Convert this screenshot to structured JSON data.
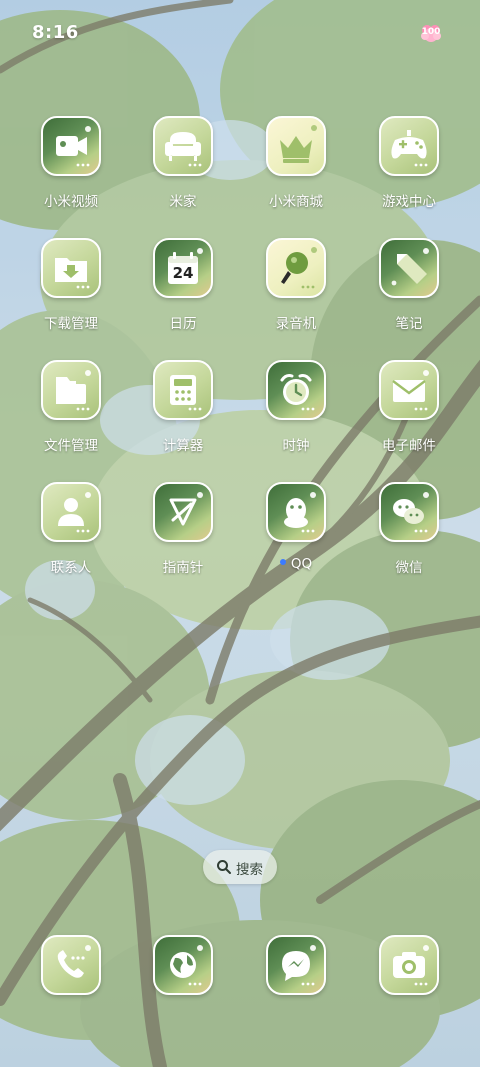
{
  "status_bar": {
    "time": "8:16",
    "battery_level": "100"
  },
  "apps": [
    {
      "label": "小米视频",
      "icon": "video-camera-icon"
    },
    {
      "label": "米家",
      "icon": "armchair-icon"
    },
    {
      "label": "小米商城",
      "icon": "crown-icon"
    },
    {
      "label": "游戏中心",
      "icon": "gamepad-icon"
    },
    {
      "label": "下载管理",
      "icon": "download-folder-icon"
    },
    {
      "label": "日历",
      "icon": "calendar-icon",
      "date": "24"
    },
    {
      "label": "录音机",
      "icon": "microphone-icon"
    },
    {
      "label": "笔记",
      "icon": "pencil-icon"
    },
    {
      "label": "文件管理",
      "icon": "folder-icon"
    },
    {
      "label": "计算器",
      "icon": "calculator-icon"
    },
    {
      "label": "时钟",
      "icon": "alarm-clock-icon"
    },
    {
      "label": "电子邮件",
      "icon": "envelope-icon"
    },
    {
      "label": "联系人",
      "icon": "person-icon"
    },
    {
      "label": "指南针",
      "icon": "compass-icon"
    },
    {
      "label": "QQ",
      "icon": "penguin-icon"
    },
    {
      "label": "微信",
      "icon": "chat-bubbles-icon"
    }
  ],
  "search": {
    "label": "搜索",
    "icon": "search-icon"
  },
  "dock": [
    {
      "icon": "phone-icon"
    },
    {
      "icon": "globe-browser-icon"
    },
    {
      "icon": "messenger-bubble-icon"
    },
    {
      "icon": "camera-icon"
    }
  ],
  "colors": {
    "icon_green_light": "#c4d79a",
    "icon_green_dark": "#3f6e3a",
    "label_text": "#ffffff",
    "notification_dot": "#3b7bff",
    "sky": "#b9d0e2"
  }
}
